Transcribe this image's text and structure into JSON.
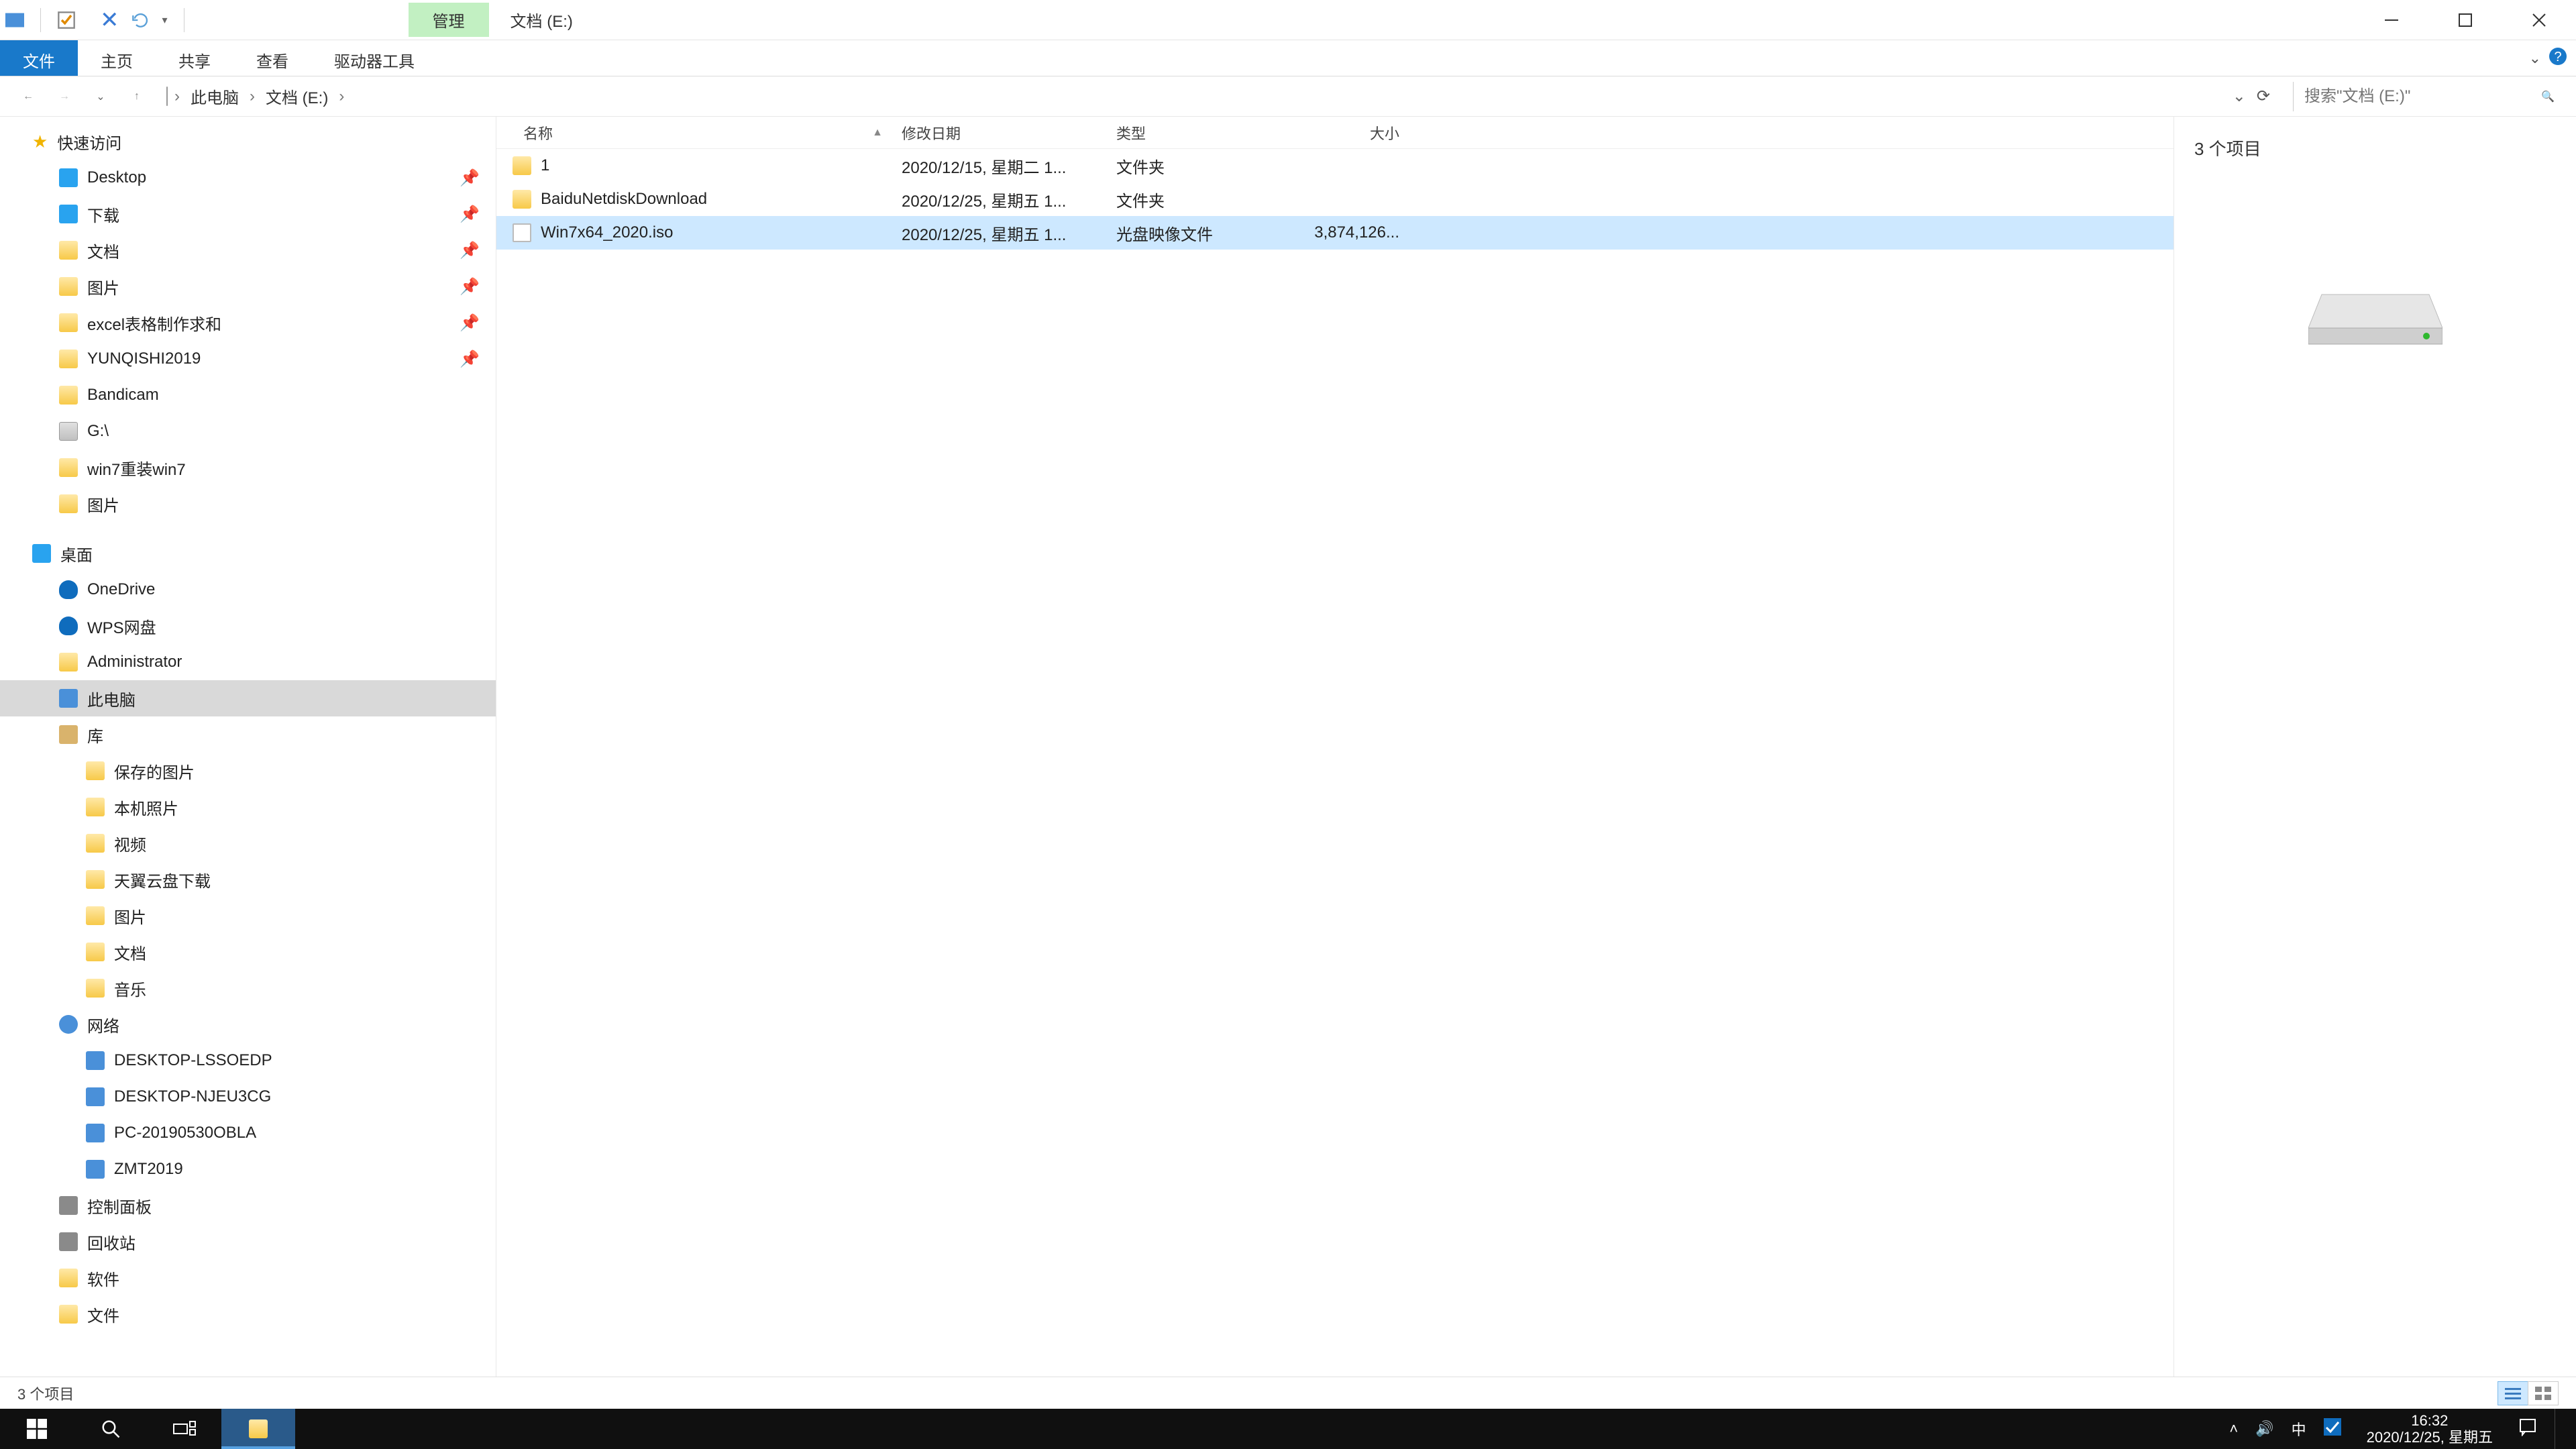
{
  "titlebar": {
    "context_tab": "管理",
    "title": "文档 (E:)"
  },
  "ribbon": {
    "file": "文件",
    "tabs": [
      "主页",
      "共享",
      "查看",
      "驱动器工具"
    ]
  },
  "breadcrumb": {
    "parts": [
      "此电脑",
      "文档 (E:)"
    ]
  },
  "search": {
    "placeholder": "搜索\"文档 (E:)\""
  },
  "tree": {
    "quick_access": "快速访问",
    "qa_items": [
      {
        "label": "Desktop",
        "icon": "desk",
        "pin": true
      },
      {
        "label": "下载",
        "icon": "dl",
        "pin": true
      },
      {
        "label": "文档",
        "icon": "folder",
        "pin": true
      },
      {
        "label": "图片",
        "icon": "folder",
        "pin": true
      },
      {
        "label": "excel表格制作求和",
        "icon": "folder",
        "pin": true
      },
      {
        "label": "YUNQISHI2019",
        "icon": "folder",
        "pin": true
      },
      {
        "label": "Bandicam",
        "icon": "folder",
        "pin": false
      },
      {
        "label": "G:\\",
        "icon": "drive",
        "pin": false
      },
      {
        "label": "win7重装win7",
        "icon": "folder",
        "pin": false
      },
      {
        "label": "图片",
        "icon": "folder",
        "pin": false
      }
    ],
    "desktop": "桌面",
    "desk_items": [
      {
        "label": "OneDrive",
        "icon": "cloud"
      },
      {
        "label": "WPS网盘",
        "icon": "cloud"
      },
      {
        "label": "Administrator",
        "icon": "folder"
      },
      {
        "label": "此电脑",
        "icon": "pc",
        "selected": true
      },
      {
        "label": "库",
        "icon": "lib"
      }
    ],
    "lib_items": [
      {
        "label": "保存的图片"
      },
      {
        "label": "本机照片"
      },
      {
        "label": "视频"
      },
      {
        "label": "天翼云盘下载"
      },
      {
        "label": "图片"
      },
      {
        "label": "文档"
      },
      {
        "label": "音乐"
      }
    ],
    "network": "网络",
    "net_items": [
      {
        "label": "DESKTOP-LSSOEDP"
      },
      {
        "label": "DESKTOP-NJEU3CG"
      },
      {
        "label": "PC-20190530OBLA"
      },
      {
        "label": "ZMT2019"
      }
    ],
    "extra": [
      {
        "label": "控制面板",
        "icon": "panel"
      },
      {
        "label": "回收站",
        "icon": "trash"
      },
      {
        "label": "软件",
        "icon": "folder"
      },
      {
        "label": "文件",
        "icon": "folder"
      }
    ]
  },
  "columns": {
    "name": "名称",
    "date": "修改日期",
    "type": "类型",
    "size": "大小"
  },
  "rows": [
    {
      "name": "1",
      "date": "2020/12/15, 星期二 1...",
      "type": "文件夹",
      "size": "",
      "icon": "folder",
      "sel": false
    },
    {
      "name": "BaiduNetdiskDownload",
      "date": "2020/12/25, 星期五 1...",
      "type": "文件夹",
      "size": "",
      "icon": "folder",
      "sel": false
    },
    {
      "name": "Win7x64_2020.iso",
      "date": "2020/12/25, 星期五 1...",
      "type": "光盘映像文件",
      "size": "3,874,126...",
      "icon": "file",
      "sel": true
    }
  ],
  "preview": {
    "count_label": "3 个项目"
  },
  "status": {
    "text": "3 个项目"
  },
  "taskbar": {
    "clock_time": "16:32",
    "clock_date": "2020/12/25, 星期五",
    "ime": "中"
  }
}
